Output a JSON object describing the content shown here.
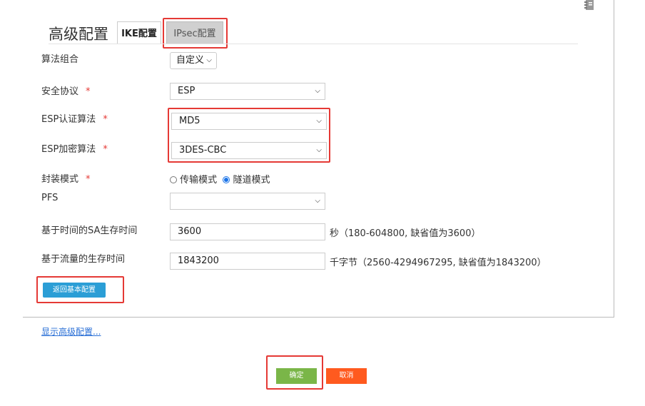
{
  "page": {
    "title": "高级配置",
    "tabs": [
      {
        "label": "IKE配置",
        "active": false
      },
      {
        "label": "IPsec配置",
        "active": true
      }
    ]
  },
  "form": {
    "algo_group": {
      "label": "算法组合",
      "value": "自定义"
    },
    "security_protocol": {
      "label": "安全协议",
      "required_mark": "*",
      "value": "ESP"
    },
    "esp_auth": {
      "label": "ESP认证算法",
      "required_mark": "*",
      "value": "MD5"
    },
    "esp_encrypt": {
      "label": "ESP加密算法",
      "required_mark": "*",
      "value": "3DES-CBC"
    },
    "encap_mode": {
      "label": "封装模式",
      "required_mark": "*",
      "options": [
        {
          "label": "传输模式",
          "selected": false
        },
        {
          "label": "隧道模式",
          "selected": true
        }
      ]
    },
    "pfs": {
      "label": "PFS",
      "value": ""
    },
    "sa_time": {
      "label": "基于时间的SA生存时间",
      "value": "3600",
      "hint": "秒（180-604800, 缺省值为3600）"
    },
    "sa_traffic": {
      "label": "基于流量的生存时间",
      "value": "1843200",
      "hint": "千字节（2560-4294967295, 缺省值为1843200）"
    }
  },
  "buttons": {
    "back_basic": "返回基本配置",
    "show_advanced": "显示高级配置...",
    "ok": "确定",
    "cancel": "取消"
  },
  "colors": {
    "highlight": "#e53935",
    "ok_button": "#7ab648",
    "cancel_button": "#ff5a1f",
    "back_button": "#2b9ed6",
    "link": "#2a6fd6",
    "radio_selected": "#1a73e8"
  },
  "icons": {
    "corner": "notebook-icon",
    "dropdown": "chevron-down-icon"
  }
}
